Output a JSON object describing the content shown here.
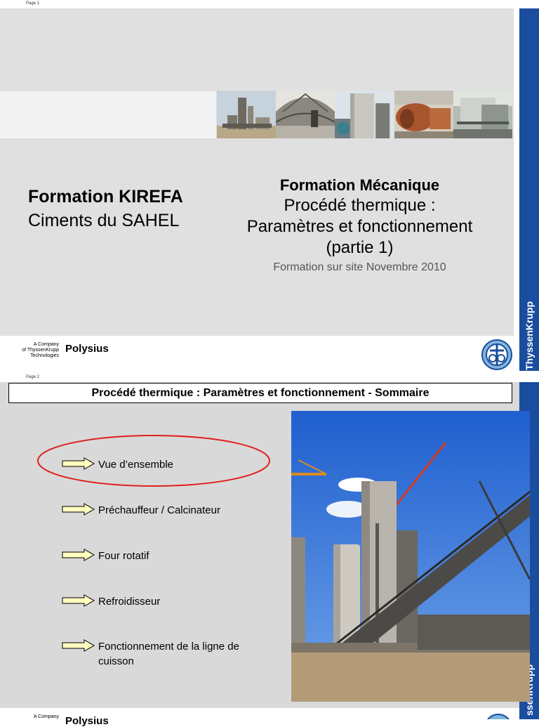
{
  "slide1": {
    "page_label": "Page 1",
    "left_title": "Formation KIREFA",
    "left_subtitle": "Ciments du SAHEL",
    "title_bold": "Formation Mécanique",
    "title_line1": "Procédé thermique :",
    "title_line2": "Paramètres et fonctionnement",
    "title_line3": "(partie 1)",
    "title_site": "Formation sur site Novembre 2010",
    "footer": {
      "company_line1": "A Company",
      "company_line2": "of ThyssenKrupp",
      "company_line3": "Technologies",
      "brand": "Polysius"
    },
    "side_brand": "ThyssenKrupp"
  },
  "slide2": {
    "page_label": "Page 2",
    "header": "Procédé thermique : Paramètres et fonctionnement - Sommaire",
    "items": [
      {
        "label": "Vue d’ensemble"
      },
      {
        "label": "Préchauffeur / Calcinateur"
      },
      {
        "label": "Four rotatif"
      },
      {
        "label": "Refroidisseur"
      },
      {
        "label": "Fonctionnement de la ligne de cuisson"
      }
    ],
    "footer": {
      "company_line1": "A Company",
      "brand": "Polysius"
    },
    "side_brand": "ssenKrupp"
  },
  "colors": {
    "thyssen_blue": "#1a4d9e",
    "highlight_ellipse": "#e0201e",
    "arrow_fill": "#ffffc0"
  }
}
